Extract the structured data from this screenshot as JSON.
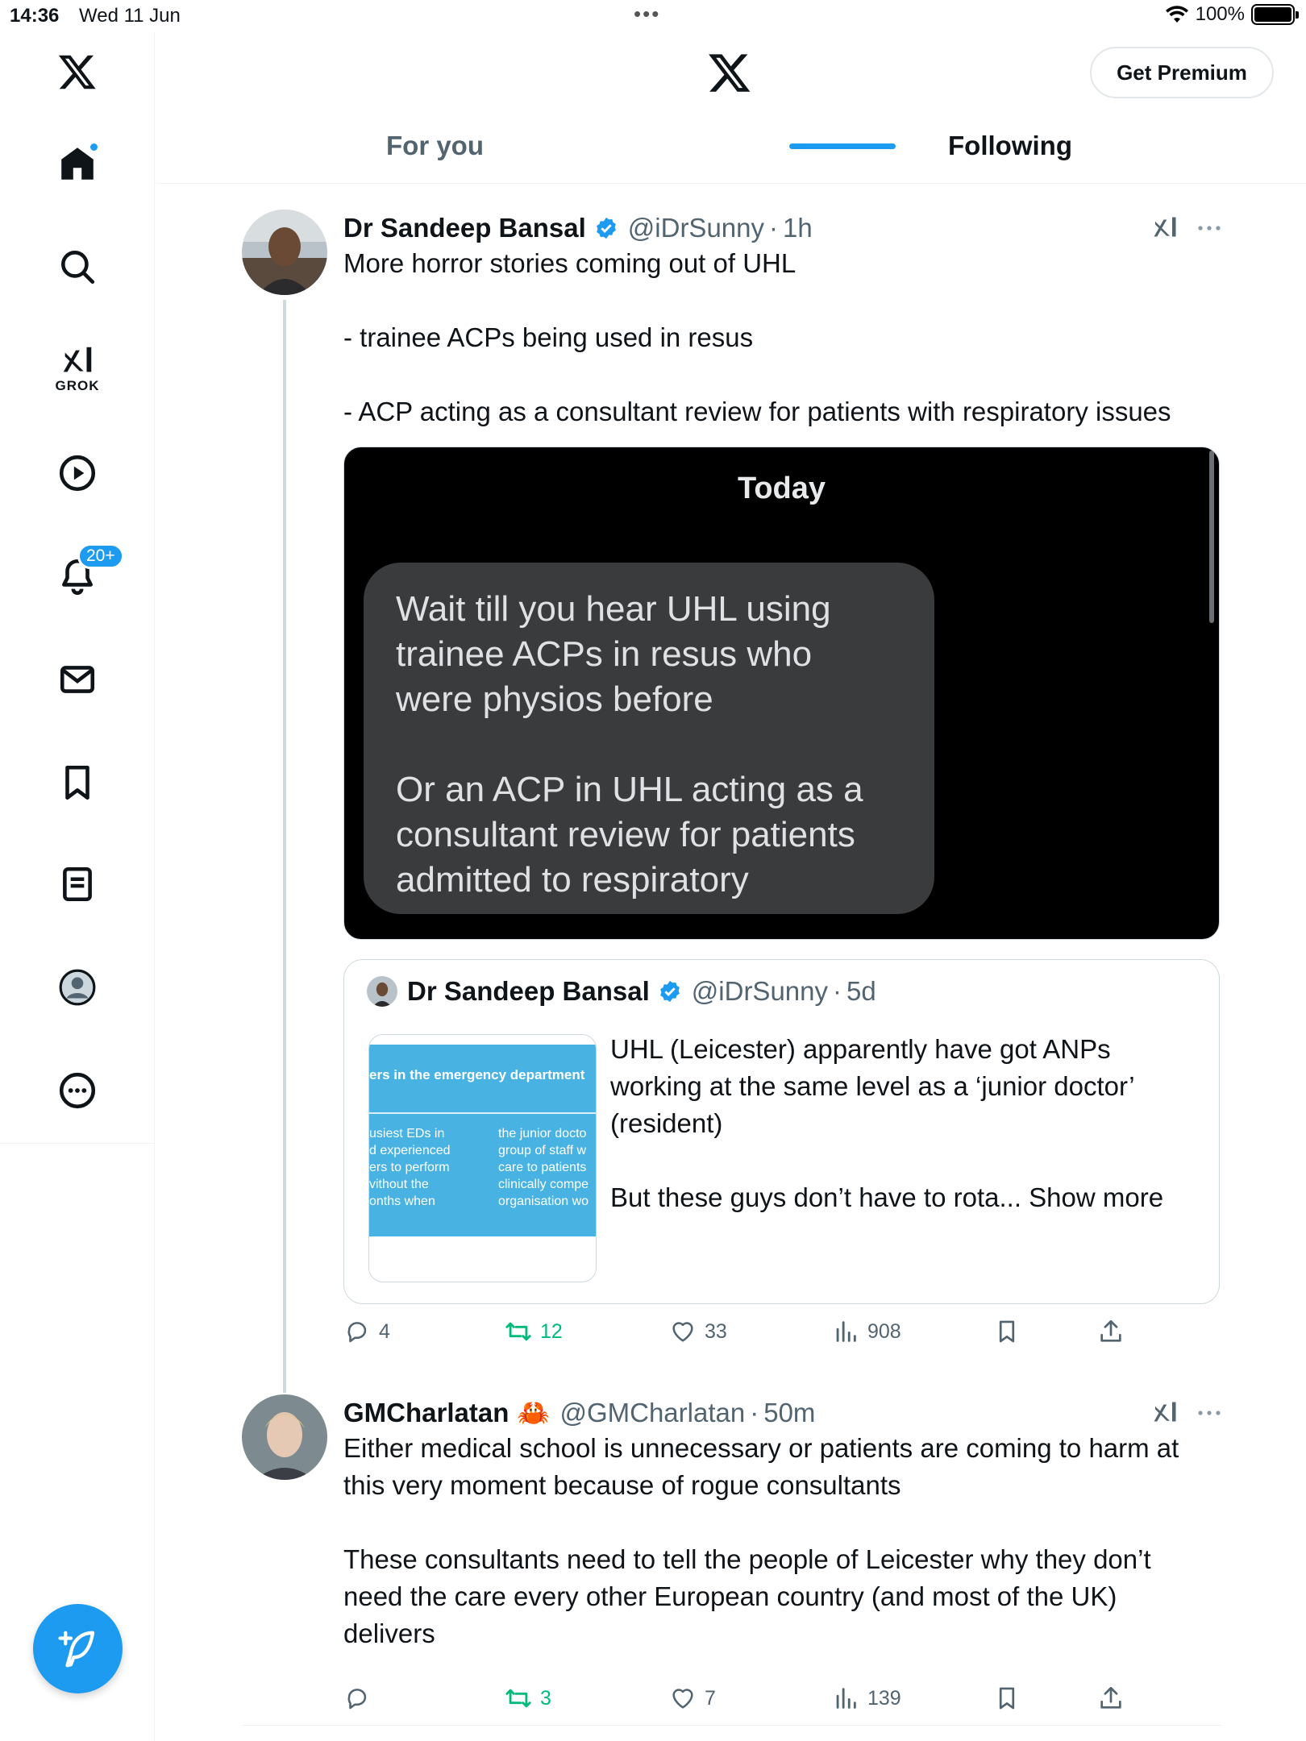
{
  "status_bar": {
    "time": "14:36",
    "date": "Wed 11 Jun",
    "battery": "100%"
  },
  "sidebar": {
    "grok_label": "GROK",
    "notifications_badge": "20+"
  },
  "header": {
    "premium_label": "Get Premium",
    "tabs": [
      {
        "label": "For you",
        "active": false
      },
      {
        "label": "Following",
        "active": true
      }
    ]
  },
  "posts": [
    {
      "name": "Dr Sandeep Bansal",
      "handle": "@iDrSunny",
      "time": "1h",
      "text_lines": [
        "More horror stories coming out of UHL",
        "",
        "- trainee ACPs being used in resus",
        "",
        "- ACP acting as a consultant review for patients with respiratory issues"
      ],
      "media": {
        "header": "Today",
        "message_lines": [
          "Wait till you hear UHL using",
          "trainee ACPs in resus who",
          "were physios before",
          "",
          "Or an ACP in UHL acting as a",
          "consultant review for patients",
          "admitted to respiratory"
        ]
      },
      "quote": {
        "name": "Dr Sandeep Bansal",
        "handle": "@iDrSunny",
        "time": "5d",
        "image": {
          "title": "ers in the emergency department",
          "col1": "usiest EDs in\nd experienced\ners to perform\nvithout the\nonths when",
          "col2": "the junior docto\ngroup of staff w\ncare to patients\nclinically compe\norganisation wo"
        },
        "text_lines": [
          "UHL (Leicester) apparently have got ANPs",
          "working at the same level as a ‘junior doctor’",
          "(resident)",
          "",
          "But these guys don’t have to rota..."
        ],
        "show_more": "Show more"
      },
      "stats": {
        "replies": "4",
        "reposts": "12",
        "likes": "33",
        "views": "908"
      }
    },
    {
      "name": "GMCharlatan",
      "emoji": "🦀",
      "handle": "@GMCharlatan",
      "time": "50m",
      "text_lines": [
        "Either medical school is unnecessary or patients are coming to harm at",
        "this very moment because of rogue consultants",
        "",
        "These consultants need to tell the people of Leicester why they don’t",
        "need the care every other European country (and most of the UK)",
        "delivers"
      ],
      "stats": {
        "replies": "",
        "reposts": "3",
        "likes": "7",
        "views": "139"
      }
    }
  ],
  "colors": {
    "accent": "#1d9bf0",
    "repost": "#00ba7c",
    "secondary_text": "#536471"
  }
}
